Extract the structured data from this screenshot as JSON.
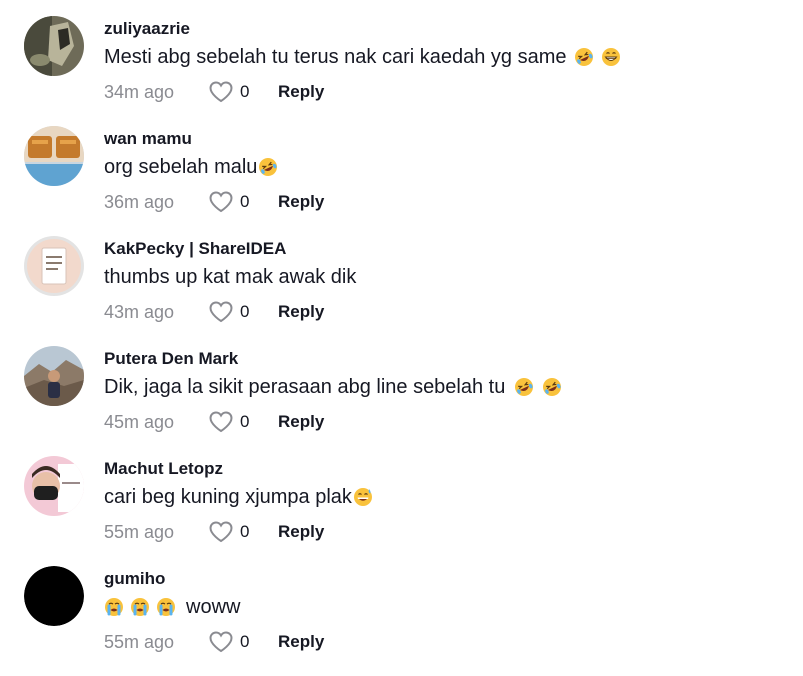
{
  "comments": [
    {
      "username": "zuliyaazrie",
      "text": "Mesti abg sebelah tu terus nak cari kaedah yg same",
      "emojis": [
        "rofl",
        "grin"
      ],
      "time": "34m ago",
      "likes": "0",
      "reply": "Reply"
    },
    {
      "username": "wan mamu",
      "text": "org sebelah malu",
      "emojis": [
        "rofl"
      ],
      "time": "36m ago",
      "likes": "0",
      "reply": "Reply"
    },
    {
      "username": "KakPecky | ShareIDEA",
      "text": "thumbs up kat mak awak dik",
      "emojis": [],
      "time": "43m ago",
      "likes": "0",
      "reply": "Reply"
    },
    {
      "username": "Putera Den Mark",
      "text": "Dik, jaga la sikit perasaan abg line sebelah tu",
      "emojis": [
        "rofl",
        "rofl"
      ],
      "time": "45m ago",
      "likes": "0",
      "reply": "Reply"
    },
    {
      "username": "Machut Letopz",
      "text": "cari beg kuning xjumpa plak",
      "emojis": [
        "sweat-smile"
      ],
      "time": "55m ago",
      "likes": "0",
      "reply": "Reply"
    },
    {
      "username": "gumiho",
      "text": "woww",
      "lead_emojis": [
        "loudly-crying",
        "loudly-crying",
        "loudly-crying"
      ],
      "emojis": [],
      "time": "55m ago",
      "likes": "0",
      "reply": "Reply"
    }
  ],
  "colors": {
    "text": "#161823",
    "muted": "#8a8b91"
  }
}
